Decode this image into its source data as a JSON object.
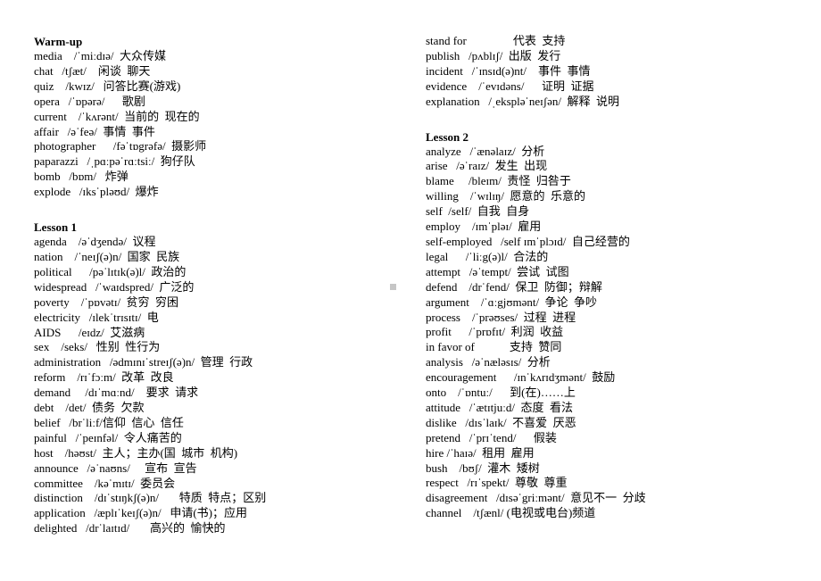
{
  "document": {
    "title": "Vocabulary List",
    "gutter_marker_color": "#c6c6c6"
  },
  "columns": {
    "left": {
      "blocks": [
        {
          "heading": "Warm-up",
          "entries": [
            {
              "line": "media    /ˈmiːdɪə/  大众传媒"
            },
            {
              "line": "chat   /tʃæt/    闲谈  聊天"
            },
            {
              "line": "quiz    /kwɪz/   问答比赛(游戏)"
            },
            {
              "line": "opera   /ˈɒpərə/      歌剧"
            },
            {
              "line": "current    /ˈkʌrənt/  当前的  现在的"
            },
            {
              "line": "affair   /əˈfeə/  事情  事件"
            },
            {
              "line": "photographer      /fəˈtɒgrəfə/  摄影师"
            },
            {
              "line": "paparazzi   /ˌpɑːpəˈrɑːtsiː/  狗仔队"
            },
            {
              "line": "bomb   /bɒm/   炸弹"
            },
            {
              "line": "explode   /ɪksˈpləʊd/  爆炸"
            }
          ]
        },
        {
          "heading": "Lesson 1",
          "entries": [
            {
              "line": "agenda    /əˈdʒendə/  议程"
            },
            {
              "line": "nation    /ˈneɪʃ(ə)n/  国家  民族"
            },
            {
              "line": "political      /pəˈlɪtɪk(ə)l/  政治的"
            },
            {
              "line": "widespread   /ˈwaɪdspred/  广泛的"
            },
            {
              "line": "poverty    /ˈpɒvətɪ/  贫穷  穷困"
            },
            {
              "line": "electricity   /ɪlekˈtrɪsɪtɪ/  电"
            },
            {
              "line": "AIDS      /eɪdz/  艾滋病"
            },
            {
              "line": "sex    /seks/   性别  性行为"
            },
            {
              "line": "administration   /ədmɪnɪˈstreɪʃ(ə)n/  管理  行政"
            },
            {
              "line": "reform    /rɪˈfɔːm/  改革  改良"
            },
            {
              "line": "demand     /dɪˈmɑːnd/    要求  请求"
            },
            {
              "line": "debt    /det/  债务  欠款"
            },
            {
              "line": "belief   /brˈliːf/信仰  信心  信任"
            },
            {
              "line": "painful   /ˈpeɪnfəl/  令人痛苦的"
            },
            {
              "line": "host    /həʊst/  主人；主办(国  城市  机构)"
            },
            {
              "line": "announce   /əˈnaʊns/     宣布  宣告"
            },
            {
              "line": "committee    /kəˈmɪtɪ/  委员会"
            },
            {
              "line": "distinction    /dɪˈstɪŋkʃ(ə)n/       特质  特点；区别"
            },
            {
              "line": "application   /æplɪˈkeɪʃ(ə)n/   申请(书)；应用"
            },
            {
              "line": "delighted   /drˈlaɪtɪd/       高兴的  愉快的"
            }
          ]
        }
      ]
    },
    "right": {
      "blocks": [
        {
          "heading": null,
          "entries": [
            {
              "line": "stand for                代表  支持"
            },
            {
              "line": "publish   /pʌblɪʃ/  出版  发行"
            },
            {
              "line": "incident   /ˈɪnsɪd(ə)nt/    事件  事情"
            },
            {
              "line": "evidence    /ˈevɪdəns/      证明  证据"
            },
            {
              "line": "explanation   /ˌekspləˈneɪʃən/  解释  说明"
            }
          ]
        },
        {
          "heading": "Lesson 2",
          "entries": [
            {
              "line": "analyze   /ˈænəlaɪz/  分析"
            },
            {
              "line": "arise   /əˈraɪz/  发生  出现"
            },
            {
              "line": "blame     /bleɪm/  责怪  归咎于"
            },
            {
              "line": "willing    /ˈwɪlɪŋ/  愿意的  乐意的"
            },
            {
              "line": "self  /self/  自我  自身"
            },
            {
              "line": "employ    /ɪmˈpləɪ/  雇用"
            },
            {
              "line": "self-employed   /self ɪmˈplɔɪd/  自己经营的"
            },
            {
              "line": "legal      /ˈliːg(ə)l/  合法的"
            },
            {
              "line": "attempt   /əˈtempt/  尝试  试图"
            },
            {
              "line": "defend    /drˈfend/  保卫  防御；辩解"
            },
            {
              "line": "argument    /ˈɑːgjʊmənt/  争论  争吵"
            },
            {
              "line": "process    /ˈprəʊses/  过程  进程"
            },
            {
              "line": "profit      /ˈprɒfɪt/  利润  收益"
            },
            {
              "line": "in favor of            支持  赞同"
            },
            {
              "line": "analysis   /əˈnæləsɪs/  分析"
            },
            {
              "line": "encouragement      /ɪnˈkʌrɪdʒmənt/  鼓励"
            },
            {
              "line": "onto    /ˈɒntuː/      到(在)……上"
            },
            {
              "line": "attitude   /ˈætɪtjuːd/  态度  看法"
            },
            {
              "line": "dislike   /dɪsˈlaɪk/  不喜爱  厌恶"
            },
            {
              "line": "pretend   /ˈprɪˈtend/      假装"
            },
            {
              "line": "hire /ˈhaɪə/  租用  雇用"
            },
            {
              "line": "bush    /bʊʃ/  灌木  矮树"
            },
            {
              "line": "respect   /rɪˈspekt/  尊敬  尊重"
            },
            {
              "line": "disagreement   /dɪsəˈgriːmənt/  意见不一  分歧"
            },
            {
              "line": "channel    /tʃænl/ (电视或电台)频道"
            }
          ]
        }
      ]
    }
  }
}
